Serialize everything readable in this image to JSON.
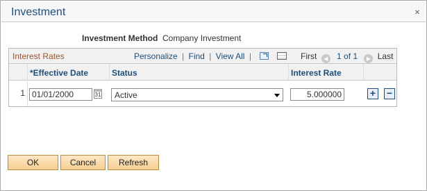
{
  "dialog": {
    "title": "Investment",
    "close_glyph": "×"
  },
  "method": {
    "label": "Investment Method",
    "value": "Company Investment"
  },
  "grid": {
    "title": "Interest Rates",
    "nav": {
      "personalize": "Personalize",
      "sep1": "|",
      "find": "Find",
      "sep2": "|",
      "view_all": "View All",
      "sep3": "|"
    },
    "pager": {
      "first": "First",
      "range": "1 of 1",
      "last": "Last"
    },
    "columns": {
      "effective_date": "*Effective Date",
      "status": "Status",
      "interest_rate": "Interest Rate"
    },
    "rows": [
      {
        "num": "1",
        "effective_date": "01/01/2000",
        "status": "Active",
        "interest_rate": "5.000000"
      }
    ],
    "add_glyph": "+",
    "del_glyph": "−",
    "cal_glyph": "31"
  },
  "buttons": {
    "ok": "OK",
    "cancel": "Cancel",
    "refresh": "Refresh"
  },
  "colors": {
    "accent": "#1f4e79",
    "grid_title": "#a0522d",
    "button_fill": "#f6cf92"
  }
}
